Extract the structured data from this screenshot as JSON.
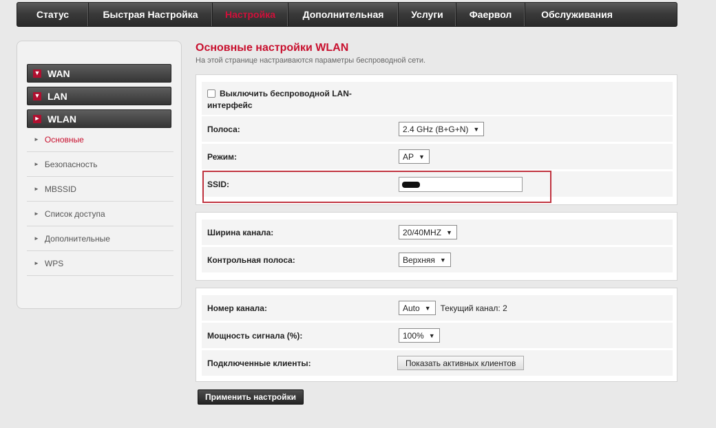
{
  "topnav": {
    "tabs": [
      {
        "label": "Статус",
        "active": false
      },
      {
        "label": "Быстрая Настройка",
        "active": false
      },
      {
        "label": "Настройка",
        "active": true
      },
      {
        "label": "Дополнительная",
        "active": false
      },
      {
        "label": "Услуги",
        "active": false
      },
      {
        "label": "Фаервол",
        "active": false
      },
      {
        "label": "Обслуживания",
        "active": false
      }
    ]
  },
  "sidebar": {
    "sections": [
      {
        "label": "WAN",
        "icon": "chevron-down-icon",
        "glyph": "▼"
      },
      {
        "label": "LAN",
        "icon": "chevron-down-icon",
        "glyph": "▼"
      },
      {
        "label": "WLAN",
        "icon": "chevron-right-icon",
        "glyph": "►"
      }
    ],
    "bullet": "►",
    "subitems": [
      {
        "label": "Основные",
        "active": true
      },
      {
        "label": "Безопасность",
        "active": false
      },
      {
        "label": "MBSSID",
        "active": false
      },
      {
        "label": "Список доступа",
        "active": false
      },
      {
        "label": "Дополнительные",
        "active": false
      },
      {
        "label": "WPS",
        "active": false
      }
    ]
  },
  "page": {
    "title": "Основные настройки WLAN",
    "description": "На этой странице настраиваются параметры беспроводной сети."
  },
  "section1": {
    "disable_label": "Выключить беспроводной LAN-интерфейс",
    "disable_checked": false,
    "band_label": "Полоса:",
    "band_value": "2.4 GHz (B+G+N)",
    "mode_label": "Режим:",
    "mode_value": "AP",
    "ssid_label": "SSID:",
    "ssid_value": ""
  },
  "section2": {
    "channel_width_label": "Ширина канала:",
    "channel_width_value": "20/40MHZ",
    "control_band_label": "Контрольная полоса:",
    "control_band_value": "Верхняя"
  },
  "section3": {
    "channel_label": "Номер канала:",
    "channel_value": "Auto",
    "current_channel_text": "Текущий канал: 2",
    "power_label": "Мощность сигнала (%):",
    "power_value": "100%",
    "clients_label": "Подключенные клиенты:",
    "clients_button": "Показать активных клиентов"
  },
  "apply_button": "Применить настройки",
  "dropdown_arrow": "▼",
  "colors": {
    "accent": "#c8102e",
    "nav_bg": "#3a3a3a",
    "page_bg": "#e9e9e9"
  }
}
